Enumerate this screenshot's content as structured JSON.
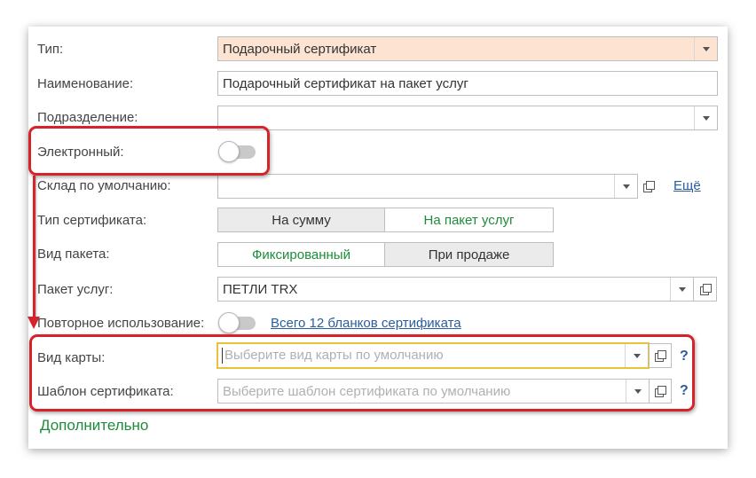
{
  "form": {
    "type_label": "Тип:",
    "type_value": "Подарочный сертификат",
    "type_bg": "#fde3d1",
    "name_label": "Наименование:",
    "name_value": "Подарочный сертификат на пакет услуг",
    "division_label": "Подразделение:",
    "division_value": "",
    "electronic_label": "Электронный:",
    "electronic_on": false,
    "warehouse_label": "Склад по умолчанию:",
    "warehouse_value": "",
    "more_link": "Ещё",
    "cert_type_label": "Тип сертификата:",
    "cert_type_options": [
      "На сумму",
      "На пакет услуг"
    ],
    "cert_type_selected": "На сумму",
    "package_kind_label": "Вид пакета:",
    "package_kind_options": [
      "Фиксированный",
      "При продаже"
    ],
    "package_kind_selected": "При продаже",
    "package_label": "Пакет услуг:",
    "package_value": "ПЕТЛИ TRX",
    "reuse_label": "Повторное использование:",
    "reuse_on": false,
    "blanks_link": "Всего 12 бланков сертификата",
    "card_kind_label": "Вид карты:",
    "card_kind_placeholder": "Выберите вид карты по умолчанию",
    "template_label": "Шаблон сертификата:",
    "template_placeholder": "Выберите шаблон сертификата по умолчанию",
    "help": "?",
    "additional": "Дополнительно"
  },
  "colors": {
    "accent_green": "#1e8c3a",
    "link_blue": "#2a5c9e",
    "annotation_red": "#d5232a",
    "focus_yellow": "#e8c33a"
  },
  "icons": [
    "dropdown-arrow-icon",
    "open-form-icon",
    "help-icon",
    "toggle-switch"
  ]
}
